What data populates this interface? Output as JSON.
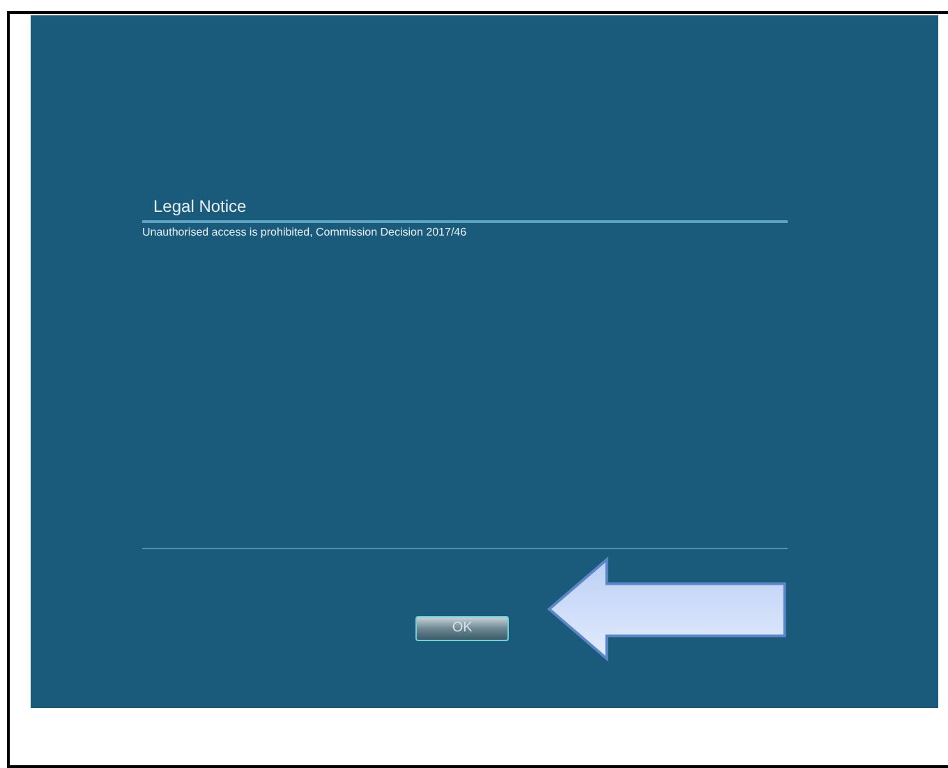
{
  "dialog": {
    "title": "Legal Notice",
    "message": "Unauthorised access is prohibited, Commission Decision 2017/46"
  },
  "buttons": [
    {
      "label": "OK"
    }
  ]
}
